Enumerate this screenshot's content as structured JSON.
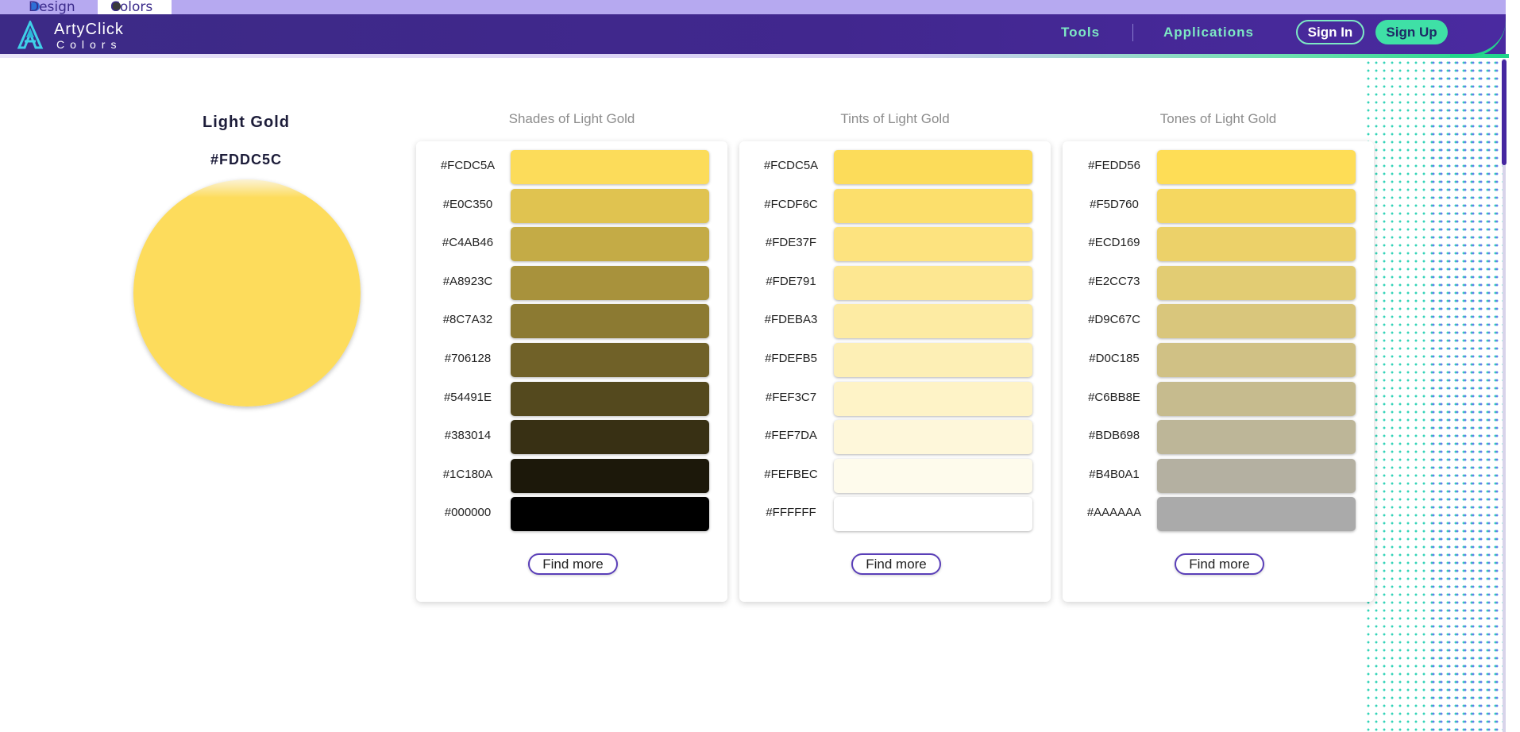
{
  "site_tabs": {
    "design_label": "Design",
    "colors_label": "Colors"
  },
  "header": {
    "brand_name": "ArtyClick",
    "brand_sub": "Colors",
    "nav_tools": "Tools",
    "nav_applications": "Applications",
    "sign_in": "Sign In",
    "sign_up": "Sign Up"
  },
  "main_color": {
    "name": "Light Gold",
    "hex": "#FDDC5C",
    "swatch": "#FDDC5C"
  },
  "shades": {
    "title": "Shades of Light Gold",
    "items": [
      {
        "hex": "#FCDC5A",
        "color": "#FCDC5A"
      },
      {
        "hex": "#E0C350",
        "color": "#E0C350"
      },
      {
        "hex": "#C4AB46",
        "color": "#C4AB46"
      },
      {
        "hex": "#A8923C",
        "color": "#A8923C"
      },
      {
        "hex": "#8C7A32",
        "color": "#8C7A32"
      },
      {
        "hex": "#706128",
        "color": "#706128"
      },
      {
        "hex": "#54491E",
        "color": "#54491E"
      },
      {
        "hex": "#383014",
        "color": "#383014"
      },
      {
        "hex": "#1C180A",
        "color": "#1C180A"
      },
      {
        "hex": "#000000",
        "color": "#000000"
      }
    ],
    "find_more": "Find more"
  },
  "tints": {
    "title": "Tints of Light Gold",
    "items": [
      {
        "hex": "#FCDC5A",
        "color": "#FCDC5A"
      },
      {
        "hex": "#FCDF6C",
        "color": "#FCDF6C"
      },
      {
        "hex": "#FDE37F",
        "color": "#FDE37F"
      },
      {
        "hex": "#FDE791",
        "color": "#FDE791"
      },
      {
        "hex": "#FDEBA3",
        "color": "#FDEBA3"
      },
      {
        "hex": "#FDEFB5",
        "color": "#FDEFB5"
      },
      {
        "hex": "#FEF3C7",
        "color": "#FEF3C7"
      },
      {
        "hex": "#FEF7DA",
        "color": "#FEF7DA"
      },
      {
        "hex": "#FEFBEC",
        "color": "#FEFBEC"
      },
      {
        "hex": "#FFFFFF",
        "color": "#FFFFFF"
      }
    ],
    "find_more": "Find more"
  },
  "tones": {
    "title": "Tones of Light Gold",
    "items": [
      {
        "hex": "#FEDD56",
        "color": "#FEDD56"
      },
      {
        "hex": "#F5D760",
        "color": "#F5D760"
      },
      {
        "hex": "#ECD169",
        "color": "#ECD169"
      },
      {
        "hex": "#E2CC73",
        "color": "#E2CC73"
      },
      {
        "hex": "#D9C67C",
        "color": "#D9C67C"
      },
      {
        "hex": "#D0C185",
        "color": "#D0C185"
      },
      {
        "hex": "#C6BB8E",
        "color": "#C6BB8E"
      },
      {
        "hex": "#BDB698",
        "color": "#BDB698"
      },
      {
        "hex": "#B4B0A1",
        "color": "#B4B0A1"
      },
      {
        "hex": "#AAAAAA",
        "color": "#AAAAAA"
      }
    ],
    "find_more": "Find more"
  },
  "icons": {
    "logo": "artyclick-a-logo-icon"
  }
}
